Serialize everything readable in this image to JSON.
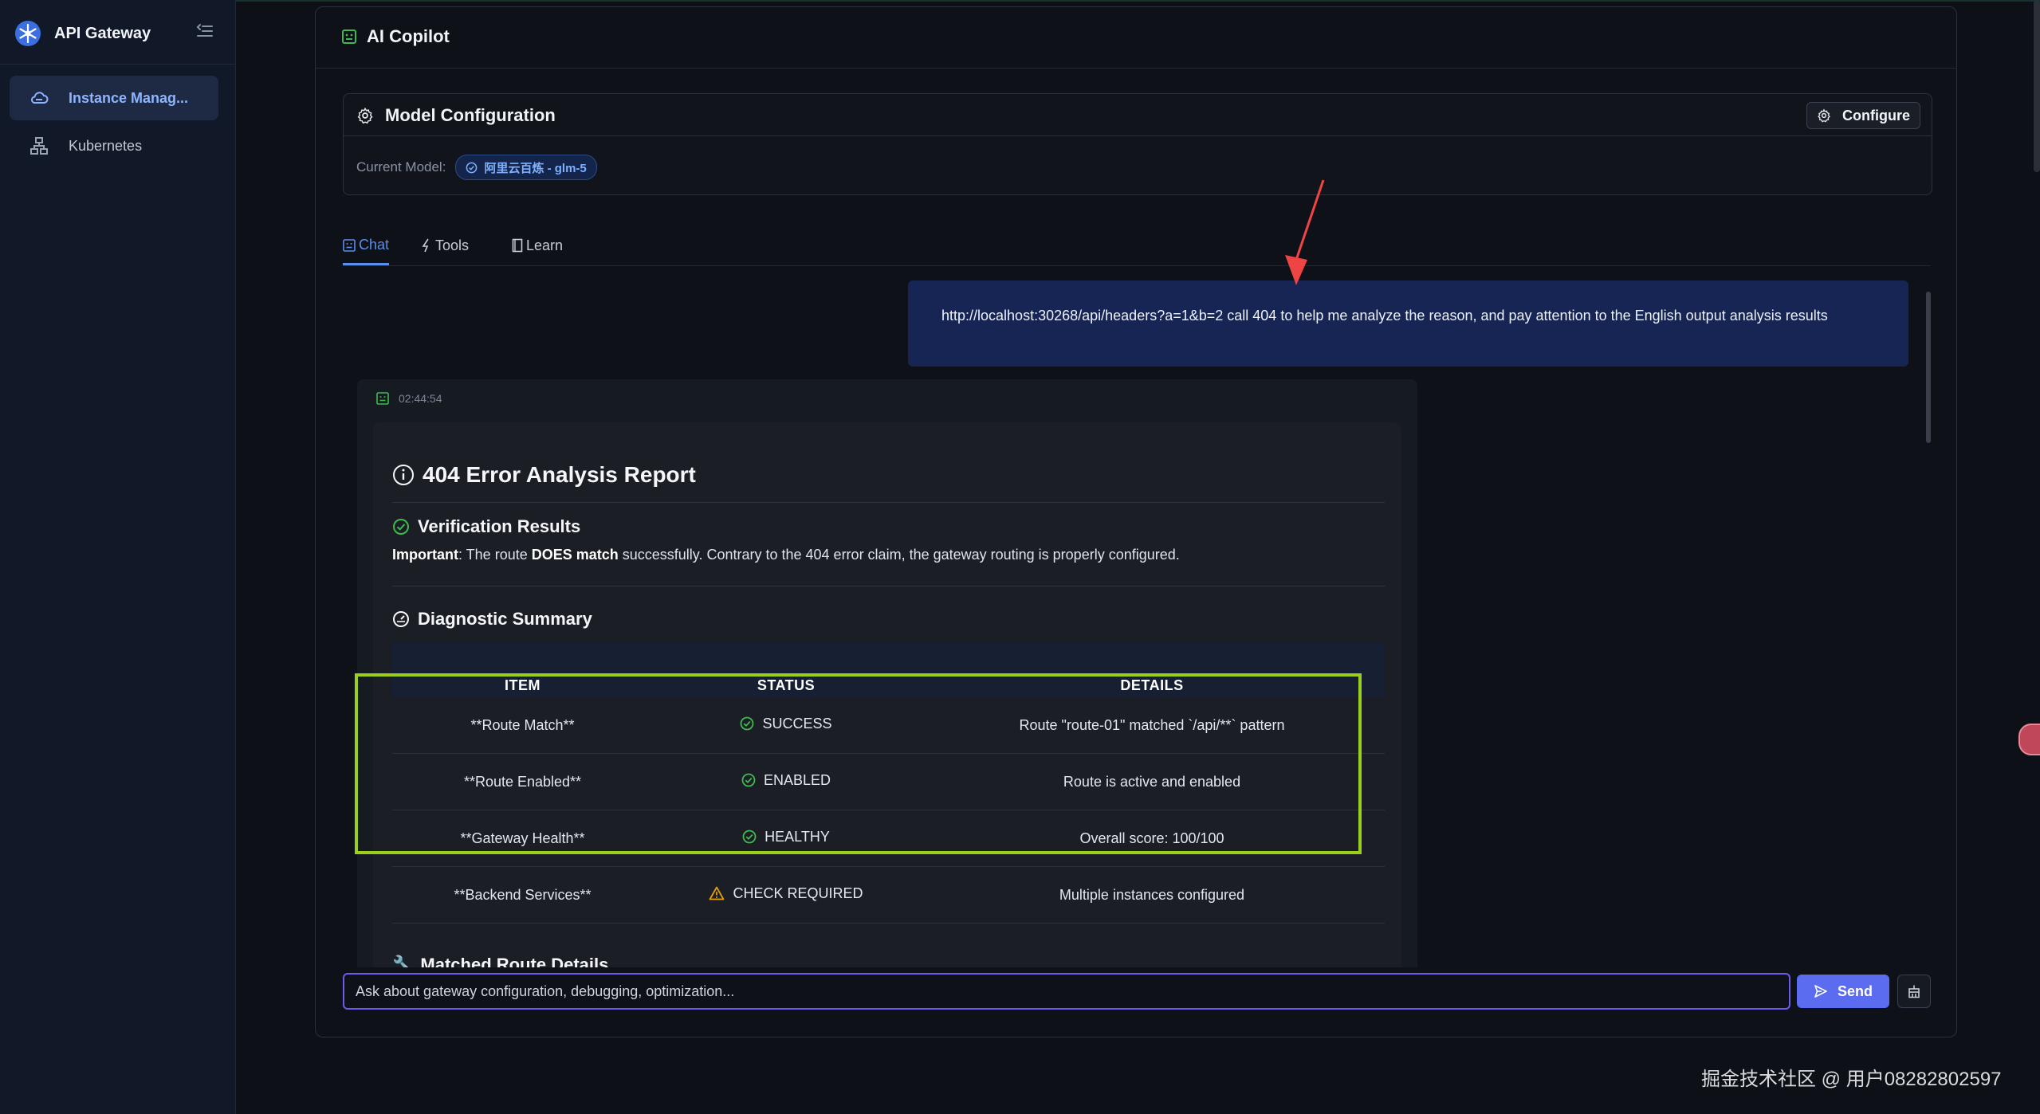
{
  "app": {
    "title": "API Gateway"
  },
  "sidebar": {
    "items": [
      {
        "label": "Instance Manag...",
        "icon": "cloud-icon",
        "active": true
      },
      {
        "label": "Kubernetes",
        "icon": "sitemap-icon",
        "active": false
      }
    ]
  },
  "panel": {
    "title": "AI Copilot"
  },
  "model_config": {
    "title": "Model Configuration",
    "configure_label": "Configure",
    "current_model_label": "Current Model:",
    "current_model_value": "阿里云百炼 - glm-5"
  },
  "tabs": [
    {
      "label": "Chat",
      "active": true
    },
    {
      "label": "Tools",
      "active": false
    },
    {
      "label": "Learn",
      "active": false
    }
  ],
  "chat": {
    "user_message": "http://localhost:30268/api/headers?a=1&b=2 call 404 to help me analyze the reason, and pay attention to the English output analysis results",
    "ai_timestamp": "02:44:54",
    "report": {
      "title": "404 Error Analysis Report",
      "verification": {
        "title": "Verification Results",
        "lead": "Important",
        "text_1": ": The route ",
        "emphasis": "DOES match",
        "text_2": " successfully. Contrary to the 404 error claim, the gateway routing is properly configured."
      },
      "diagnostic": {
        "title": "Diagnostic Summary",
        "headers": [
          "ITEM",
          "STATUS",
          "DETAILS"
        ],
        "rows": [
          {
            "item": "**Route Match**",
            "status": "SUCCESS",
            "status_icon": "check-circle-icon",
            "details": "Route \"route-01\" matched `/api/**` pattern"
          },
          {
            "item": "**Route Enabled**",
            "status": "ENABLED",
            "status_icon": "check-circle-icon",
            "details": "Route is active and enabled"
          },
          {
            "item": "**Gateway Health**",
            "status": "HEALTHY",
            "status_icon": "check-circle-icon",
            "details": "Overall score: 100/100"
          },
          {
            "item": "**Backend Services**",
            "status": "CHECK REQUIRED",
            "status_icon": "warning-icon",
            "details": "Multiple instances configured"
          }
        ]
      },
      "next_section_partial": "Matched Route Details"
    }
  },
  "composer": {
    "placeholder": "Ask about gateway configuration, debugging, optimization...",
    "send_label": "Send"
  },
  "watermark": "掘金技术社区 @ 用户08282802597",
  "colors": {
    "accent": "#5b8def",
    "success": "#3fb950",
    "warning": "#e3a008",
    "highlight_box": "#9ad01a",
    "annotation_arrow": "#ef4444"
  }
}
